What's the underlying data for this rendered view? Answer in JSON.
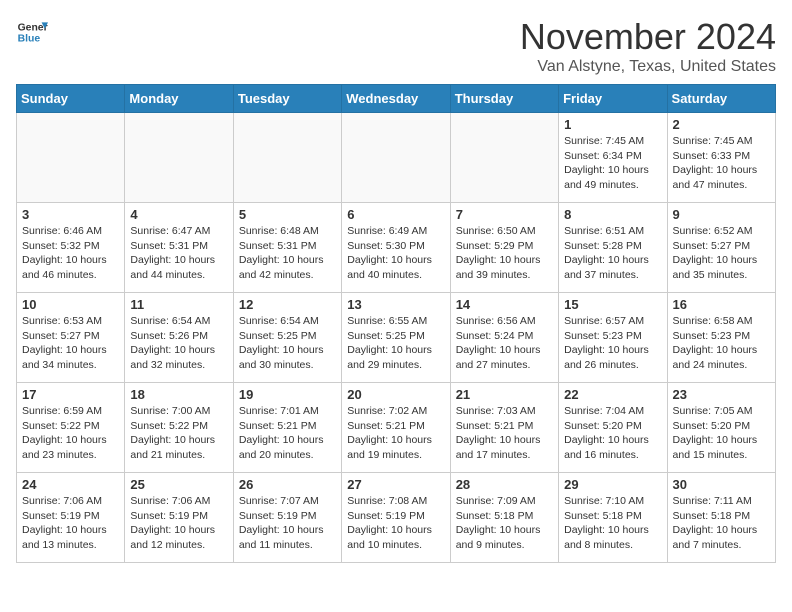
{
  "logo": {
    "general": "General",
    "blue": "Blue"
  },
  "header": {
    "month": "November 2024",
    "location": "Van Alstyne, Texas, United States"
  },
  "weekdays": [
    "Sunday",
    "Monday",
    "Tuesday",
    "Wednesday",
    "Thursday",
    "Friday",
    "Saturday"
  ],
  "weeks": [
    [
      {
        "day": "",
        "info": ""
      },
      {
        "day": "",
        "info": ""
      },
      {
        "day": "",
        "info": ""
      },
      {
        "day": "",
        "info": ""
      },
      {
        "day": "",
        "info": ""
      },
      {
        "day": "1",
        "info": "Sunrise: 7:45 AM\nSunset: 6:34 PM\nDaylight: 10 hours and 49 minutes."
      },
      {
        "day": "2",
        "info": "Sunrise: 7:45 AM\nSunset: 6:33 PM\nDaylight: 10 hours and 47 minutes."
      }
    ],
    [
      {
        "day": "3",
        "info": "Sunrise: 6:46 AM\nSunset: 5:32 PM\nDaylight: 10 hours and 46 minutes."
      },
      {
        "day": "4",
        "info": "Sunrise: 6:47 AM\nSunset: 5:31 PM\nDaylight: 10 hours and 44 minutes."
      },
      {
        "day": "5",
        "info": "Sunrise: 6:48 AM\nSunset: 5:31 PM\nDaylight: 10 hours and 42 minutes."
      },
      {
        "day": "6",
        "info": "Sunrise: 6:49 AM\nSunset: 5:30 PM\nDaylight: 10 hours and 40 minutes."
      },
      {
        "day": "7",
        "info": "Sunrise: 6:50 AM\nSunset: 5:29 PM\nDaylight: 10 hours and 39 minutes."
      },
      {
        "day": "8",
        "info": "Sunrise: 6:51 AM\nSunset: 5:28 PM\nDaylight: 10 hours and 37 minutes."
      },
      {
        "day": "9",
        "info": "Sunrise: 6:52 AM\nSunset: 5:27 PM\nDaylight: 10 hours and 35 minutes."
      }
    ],
    [
      {
        "day": "10",
        "info": "Sunrise: 6:53 AM\nSunset: 5:27 PM\nDaylight: 10 hours and 34 minutes."
      },
      {
        "day": "11",
        "info": "Sunrise: 6:54 AM\nSunset: 5:26 PM\nDaylight: 10 hours and 32 minutes."
      },
      {
        "day": "12",
        "info": "Sunrise: 6:54 AM\nSunset: 5:25 PM\nDaylight: 10 hours and 30 minutes."
      },
      {
        "day": "13",
        "info": "Sunrise: 6:55 AM\nSunset: 5:25 PM\nDaylight: 10 hours and 29 minutes."
      },
      {
        "day": "14",
        "info": "Sunrise: 6:56 AM\nSunset: 5:24 PM\nDaylight: 10 hours and 27 minutes."
      },
      {
        "day": "15",
        "info": "Sunrise: 6:57 AM\nSunset: 5:23 PM\nDaylight: 10 hours and 26 minutes."
      },
      {
        "day": "16",
        "info": "Sunrise: 6:58 AM\nSunset: 5:23 PM\nDaylight: 10 hours and 24 minutes."
      }
    ],
    [
      {
        "day": "17",
        "info": "Sunrise: 6:59 AM\nSunset: 5:22 PM\nDaylight: 10 hours and 23 minutes."
      },
      {
        "day": "18",
        "info": "Sunrise: 7:00 AM\nSunset: 5:22 PM\nDaylight: 10 hours and 21 minutes."
      },
      {
        "day": "19",
        "info": "Sunrise: 7:01 AM\nSunset: 5:21 PM\nDaylight: 10 hours and 20 minutes."
      },
      {
        "day": "20",
        "info": "Sunrise: 7:02 AM\nSunset: 5:21 PM\nDaylight: 10 hours and 19 minutes."
      },
      {
        "day": "21",
        "info": "Sunrise: 7:03 AM\nSunset: 5:21 PM\nDaylight: 10 hours and 17 minutes."
      },
      {
        "day": "22",
        "info": "Sunrise: 7:04 AM\nSunset: 5:20 PM\nDaylight: 10 hours and 16 minutes."
      },
      {
        "day": "23",
        "info": "Sunrise: 7:05 AM\nSunset: 5:20 PM\nDaylight: 10 hours and 15 minutes."
      }
    ],
    [
      {
        "day": "24",
        "info": "Sunrise: 7:06 AM\nSunset: 5:19 PM\nDaylight: 10 hours and 13 minutes."
      },
      {
        "day": "25",
        "info": "Sunrise: 7:06 AM\nSunset: 5:19 PM\nDaylight: 10 hours and 12 minutes."
      },
      {
        "day": "26",
        "info": "Sunrise: 7:07 AM\nSunset: 5:19 PM\nDaylight: 10 hours and 11 minutes."
      },
      {
        "day": "27",
        "info": "Sunrise: 7:08 AM\nSunset: 5:19 PM\nDaylight: 10 hours and 10 minutes."
      },
      {
        "day": "28",
        "info": "Sunrise: 7:09 AM\nSunset: 5:18 PM\nDaylight: 10 hours and 9 minutes."
      },
      {
        "day": "29",
        "info": "Sunrise: 7:10 AM\nSunset: 5:18 PM\nDaylight: 10 hours and 8 minutes."
      },
      {
        "day": "30",
        "info": "Sunrise: 7:11 AM\nSunset: 5:18 PM\nDaylight: 10 hours and 7 minutes."
      }
    ]
  ]
}
